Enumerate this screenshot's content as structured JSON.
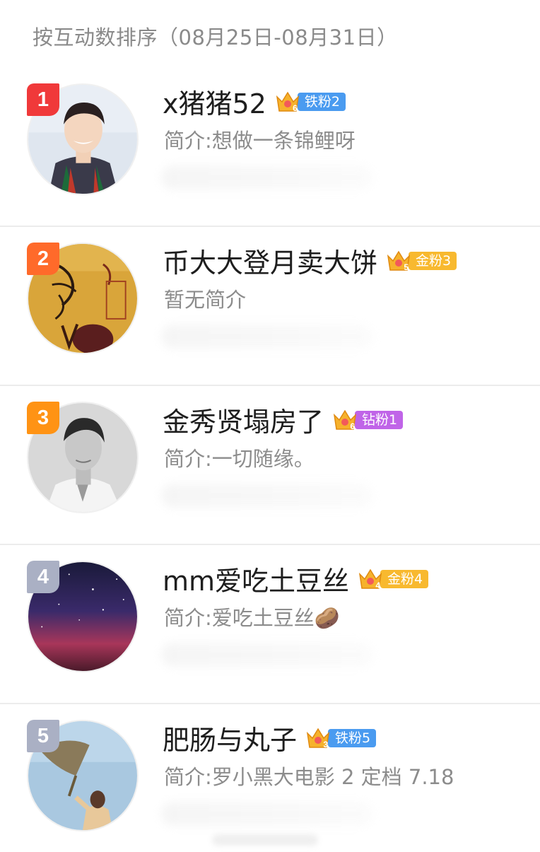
{
  "header": {
    "title": "按互动数排序（08月25日-08月31日）"
  },
  "colors": {
    "rank1": "#f0393a",
    "rank2": "#ff6a2a",
    "rank3": "#ff9314",
    "rank_other": "#aab0c4",
    "iron": "#4a9bf0",
    "gold": "#f8b92f",
    "diamond": "#c064e8"
  },
  "users": [
    {
      "rank": "1",
      "name": "x猪猪52",
      "crown_level": "6",
      "badge": "铁粉2",
      "badge_type": "iron",
      "bio": "简介:想做一条锦鲤呀",
      "avatar_icon": "person-portrait-icon"
    },
    {
      "rank": "2",
      "name": "币大大登月卖大饼",
      "crown_level": "5",
      "badge": "金粉3",
      "badge_type": "gold",
      "bio": "暂无简介",
      "avatar_icon": "calligraphy-image-icon"
    },
    {
      "rank": "3",
      "name": "金秀贤塌房了",
      "crown_level": "6",
      "badge": "钻粉1",
      "badge_type": "diamond",
      "bio": "简介:一切随缘。",
      "avatar_icon": "person-portrait-icon"
    },
    {
      "rank": "4",
      "name": "mm爱吃土豆丝",
      "crown_level": "4",
      "badge": "金粉4",
      "badge_type": "gold",
      "bio": "简介:爱吃土豆丝🥔",
      "avatar_icon": "starry-sky-icon"
    },
    {
      "rank": "5",
      "name": "肥肠与丸子",
      "crown_level": "3",
      "badge": "铁粉5",
      "badge_type": "iron",
      "bio": "简介:罗小黑大电影 2 定档 7.18",
      "avatar_icon": "person-kite-icon"
    }
  ]
}
